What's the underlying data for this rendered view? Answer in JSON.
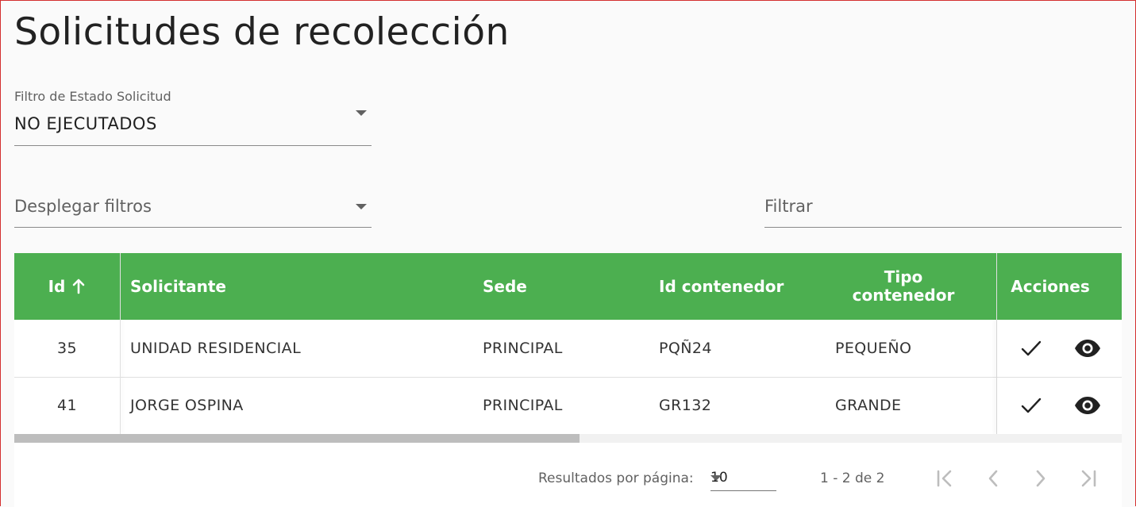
{
  "page": {
    "title": "Solicitudes de recolección"
  },
  "filters": {
    "estado": {
      "label": "Filtro de Estado Solicitud",
      "value": "NO EJECUTADOS"
    },
    "desplegar": {
      "placeholder": "Desplegar filtros"
    },
    "filtrar": {
      "placeholder": "Filtrar"
    }
  },
  "table": {
    "headers": {
      "id": "Id",
      "solicitante": "Solicitante",
      "sede": "Sede",
      "id_contenedor": "Id contenedor",
      "tipo_contenedor_1": "Tipo",
      "tipo_contenedor_2": "contenedor",
      "acciones": "Acciones"
    },
    "sort_icon": "arrow-up-icon",
    "rows": [
      {
        "id": "35",
        "solicitante": "UNIDAD RESIDENCIAL",
        "sede": "PRINCIPAL",
        "id_contenedor": "PQÑ24",
        "tipo_contenedor": "PEQUEÑO"
      },
      {
        "id": "41",
        "solicitante": "JORGE OSPINA",
        "sede": "PRINCIPAL",
        "id_contenedor": "GR132",
        "tipo_contenedor": "GRANDE"
      }
    ],
    "row_actions": [
      "check-icon",
      "eye-icon"
    ]
  },
  "paginator": {
    "label": "Resultados por página:",
    "page_size": "10",
    "range": "1 - 2 de 2"
  },
  "colors": {
    "header_bg": "#4caf50",
    "accent": "#4caf50"
  }
}
